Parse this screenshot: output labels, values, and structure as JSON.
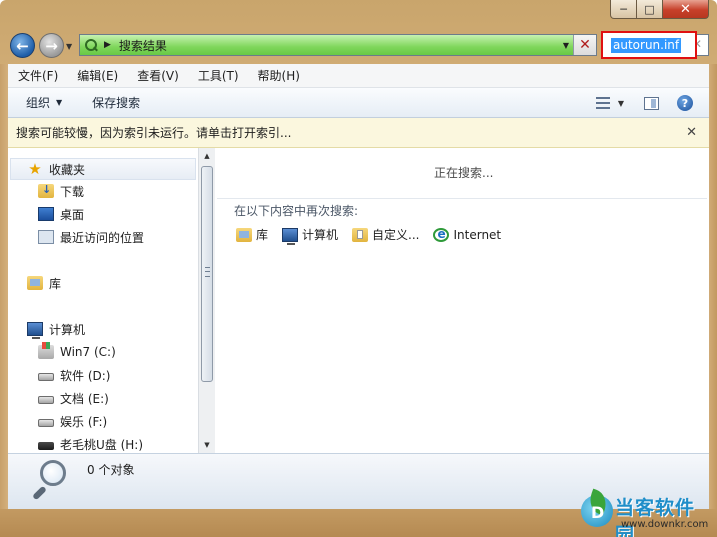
{
  "window": {
    "caption_min": "─",
    "caption_max": "□",
    "caption_close": "✕"
  },
  "address": {
    "back_arrow": "←",
    "forward_arrow": "→",
    "path": "搜索结果",
    "clear_symbol": "✕"
  },
  "search": {
    "value": "autorun.inf",
    "clear_symbol": "✕"
  },
  "menubar": {
    "items": [
      "文件(F)",
      "编辑(E)",
      "查看(V)",
      "工具(T)",
      "帮助(H)"
    ]
  },
  "toolbar": {
    "organize_label": "组织",
    "save_search_label": "保存搜索",
    "help_symbol": "?"
  },
  "infobar": {
    "text": "搜索可能较慢，因为索引未运行。请单击打开索引...",
    "close_symbol": "✕"
  },
  "navpane": {
    "favorites": "收藏夹",
    "downloads": "下载",
    "desktop": "桌面",
    "recent": "最近访问的位置",
    "libraries": "库",
    "computer": "计算机",
    "drives": [
      "Win7 (C:)",
      "软件 (D:)",
      "文档 (E:)",
      "娱乐 (F:)",
      "老毛桃U盘 (H:)"
    ]
  },
  "content": {
    "status": "正在搜索...",
    "search_again_label": "在以下内容中再次搜索:",
    "options": [
      "库",
      "计算机",
      "自定义...",
      "Internet"
    ]
  },
  "details": {
    "count_text": "0 个对象"
  },
  "watermark": {
    "name": "当客软件园",
    "url": "www.downkr.com"
  }
}
